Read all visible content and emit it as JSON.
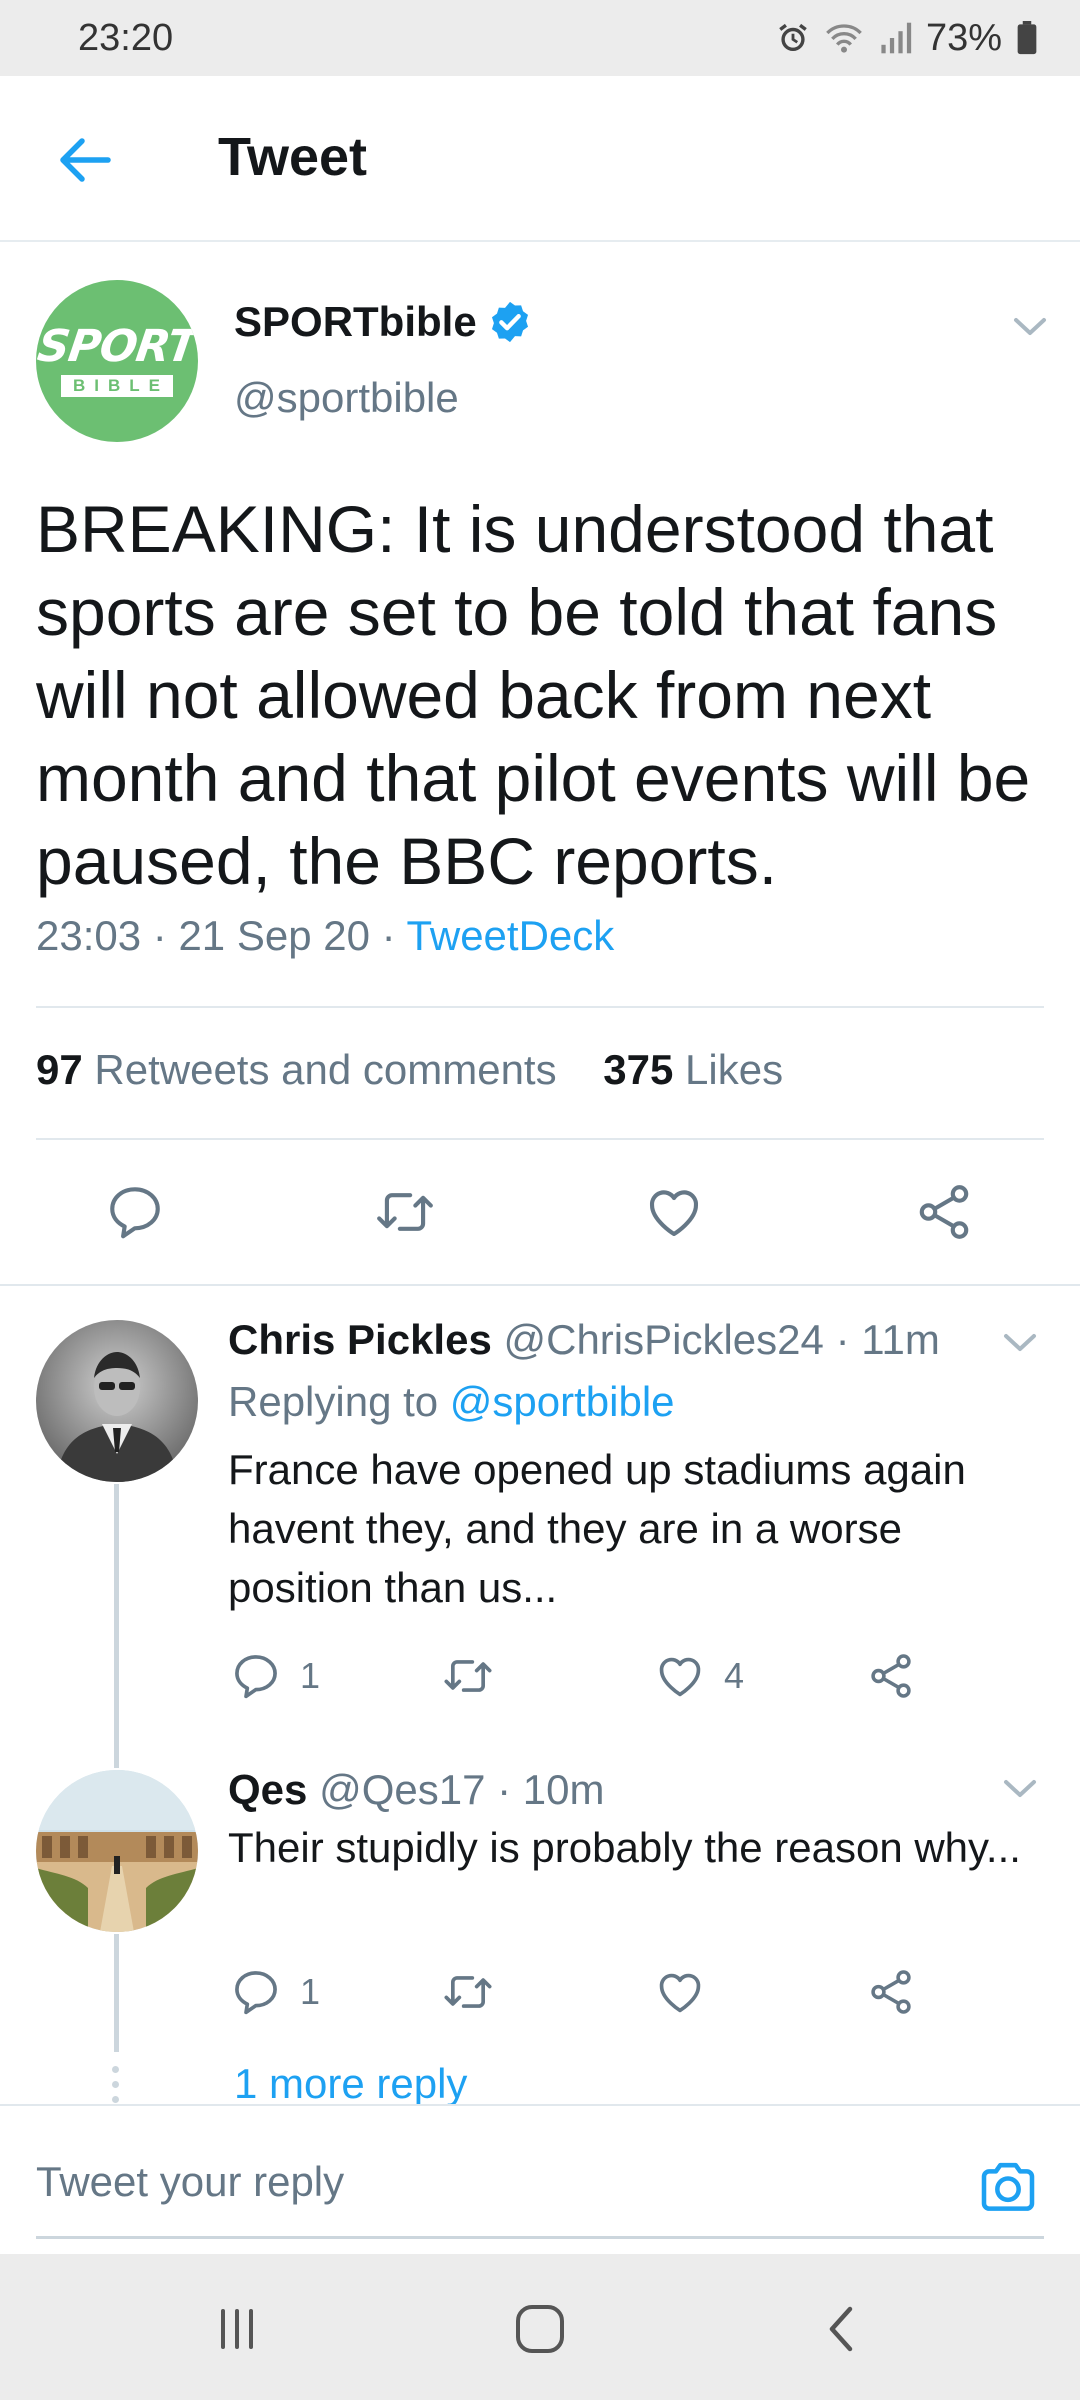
{
  "status_bar": {
    "time": "23:20",
    "battery": "73%"
  },
  "header": {
    "title": "Tweet"
  },
  "tweet": {
    "author_name": "SPORTbible",
    "author_handle": "@sportbible",
    "logo_top": "SPORT",
    "logo_bottom": "BIBLE",
    "text": "BREAKING: It is understood that sports are set to be told that fans will not allowed back from next month and that pilot events will be paused, the BBC reports.",
    "time": "23:03",
    "date": "21 Sep 20",
    "source": "TweetDeck",
    "retweets_count": "97",
    "retweets_label": "Retweets and comments",
    "likes_count": "375",
    "likes_label": "Likes"
  },
  "replies": [
    {
      "name": "Chris Pickles",
      "handle": "@ChrisPickles24",
      "age": "11m",
      "replying_prefix": "Replying to",
      "replying_to": "@sportbible",
      "text": "France have opened up stadiums again havent they, and they are in a worse position than us...",
      "comments": "1",
      "likes": "4"
    },
    {
      "name": "Qes",
      "handle": "@Qes17",
      "age": "10m",
      "text": "Their stupidly is probably the reason why...",
      "comments": "1"
    }
  ],
  "more_reply": "1 more reply",
  "composer": {
    "placeholder": "Tweet your reply"
  },
  "colors": {
    "accent": "#1da1f2",
    "secondary_text": "#657786",
    "logo_green": "#6cbf72"
  },
  "icons": [
    "back-arrow-icon",
    "verified-badge-icon",
    "chevron-down-icon",
    "comment-icon",
    "retweet-icon",
    "heart-icon",
    "share-icon",
    "camera-icon",
    "recents-icon",
    "home-icon",
    "back-icon"
  ]
}
